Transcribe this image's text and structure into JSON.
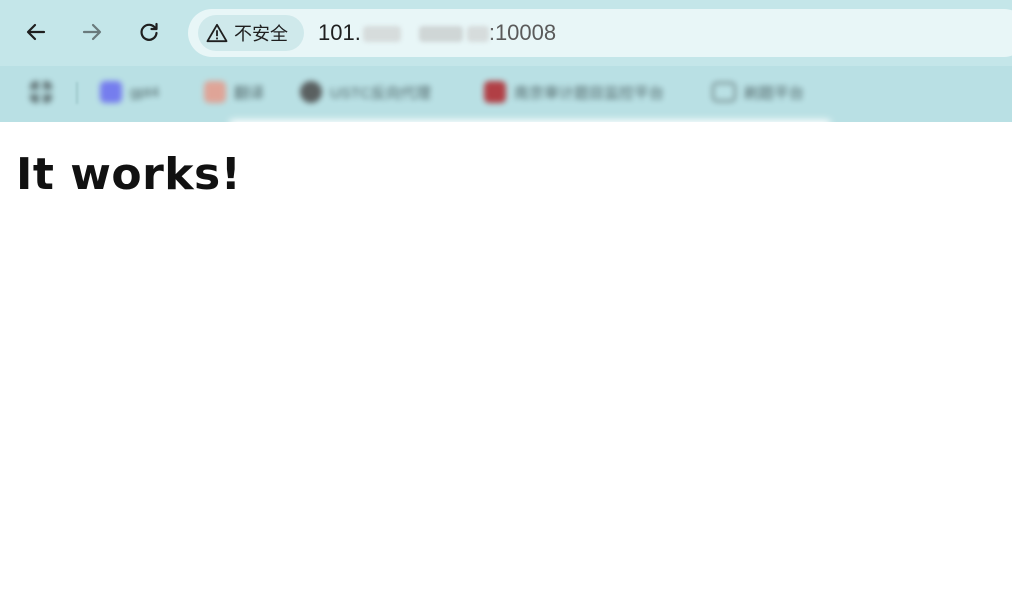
{
  "browser": {
    "security_chip": {
      "icon": "warning-triangle-icon",
      "label": "不安全"
    },
    "url": {
      "prefix": "101.",
      "suffix": ":10008"
    },
    "toolbar": {
      "back_icon": "arrow-left-icon",
      "forward_icon": "arrow-right-icon",
      "reload_icon": "reload-icon"
    },
    "bookmarks": [
      {
        "icon": "apps-grid-icon",
        "label": ""
      },
      {
        "icon": "bookmark-favicon",
        "label": "gpt4",
        "color": "#6a6cf0"
      },
      {
        "icon": "bookmark-favicon",
        "label": "翻译",
        "color": "#e69a8a"
      },
      {
        "icon": "bookmark-favicon",
        "label": "USTC反向代理",
        "color": "#4a4a4a"
      },
      {
        "icon": "bookmark-favicon",
        "label": "南京审计题目监控平台",
        "color": "#b0242a"
      },
      {
        "icon": "folder-icon",
        "label": "刷题平台"
      }
    ]
  },
  "page": {
    "heading": "It works!"
  },
  "colors": {
    "chrome_bg": "#b9e0e4",
    "omnibox_bg": "#e8f6f7",
    "text": "#111111"
  }
}
